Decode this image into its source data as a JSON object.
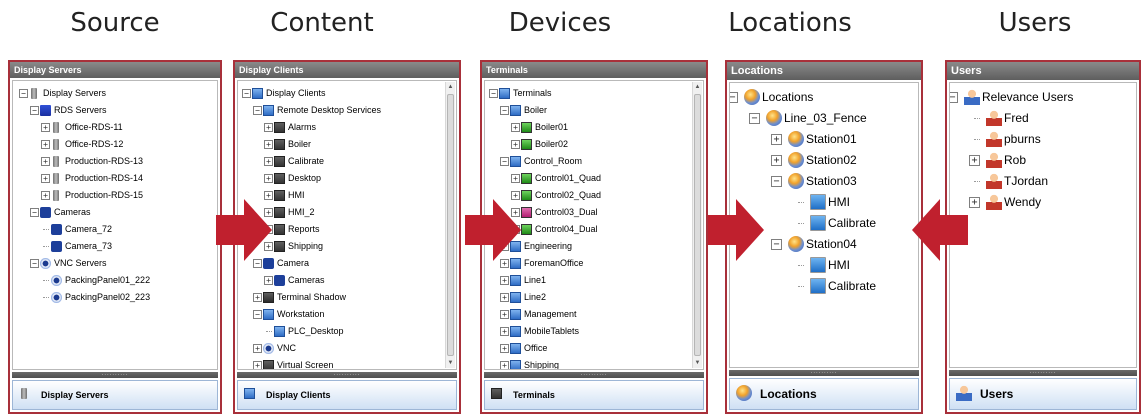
{
  "headings": [
    "Source",
    "Content",
    "Devices",
    "Locations",
    "Users"
  ],
  "colors": {
    "accent_border": "#a8303a",
    "arrow": "#c0202e",
    "footer_bg": "#cfe0f4"
  },
  "panels": {
    "source": {
      "title": "Display Servers",
      "footer": "Display Servers",
      "rows": [
        {
          "label": "Display Servers",
          "icon": "server-icon",
          "exp": "-"
        },
        {
          "label": "RDS Servers",
          "icon": "rds-server-icon",
          "exp": "-"
        },
        {
          "label": "Office-RDS-11",
          "icon": "server-icon",
          "exp": "+"
        },
        {
          "label": "Office-RDS-12",
          "icon": "server-icon",
          "exp": "+"
        },
        {
          "label": "Production-RDS-13",
          "icon": "server-icon",
          "exp": "+"
        },
        {
          "label": "Production-RDS-14",
          "icon": "server-icon",
          "exp": "+"
        },
        {
          "label": "Production-RDS-15",
          "icon": "server-icon",
          "exp": "+"
        },
        {
          "label": "Cameras",
          "icon": "camera-icon",
          "exp": "-"
        },
        {
          "label": "Camera_72",
          "icon": "camera-icon",
          "exp": ""
        },
        {
          "label": "Camera_73",
          "icon": "camera-icon",
          "exp": ""
        },
        {
          "label": "VNC Servers",
          "icon": "eye-icon",
          "exp": "-"
        },
        {
          "label": "PackingPanel01_222",
          "icon": "eye-icon",
          "exp": ""
        },
        {
          "label": "PackingPanel02_223",
          "icon": "eye-icon",
          "exp": ""
        }
      ]
    },
    "content": {
      "title": "Display Clients",
      "footer": "Display Clients",
      "rows": [
        {
          "label": "Display Clients",
          "icon": "client-icon",
          "exp": "-"
        },
        {
          "label": "Remote Desktop Services",
          "icon": "client-icon",
          "exp": "-"
        },
        {
          "label": "Alarms",
          "icon": "monitor-icon",
          "exp": "+"
        },
        {
          "label": "Boiler",
          "icon": "monitor-icon",
          "exp": "+"
        },
        {
          "label": "Calibrate",
          "icon": "monitor-icon",
          "exp": "+"
        },
        {
          "label": "Desktop",
          "icon": "monitor-icon",
          "exp": "+"
        },
        {
          "label": "HMI",
          "icon": "monitor-icon",
          "exp": "+"
        },
        {
          "label": "HMI_2",
          "icon": "monitor-icon",
          "exp": "+"
        },
        {
          "label": "Reports",
          "icon": "monitor-icon",
          "exp": "+"
        },
        {
          "label": "Shipping",
          "icon": "monitor-icon",
          "exp": "+"
        },
        {
          "label": "Camera",
          "icon": "camera-icon",
          "exp": "-"
        },
        {
          "label": "Cameras",
          "icon": "camera-icon",
          "exp": "+"
        },
        {
          "label": "Terminal Shadow",
          "icon": "shadow-icon",
          "exp": "+"
        },
        {
          "label": "Workstation",
          "icon": "workstation-icon",
          "exp": "-"
        },
        {
          "label": "PLC_Desktop",
          "icon": "workstation-icon",
          "exp": ""
        },
        {
          "label": "VNC",
          "icon": "eye-icon",
          "exp": "+"
        },
        {
          "label": "Virtual Screen",
          "icon": "monitor-icon",
          "exp": "+"
        }
      ]
    },
    "devices": {
      "title": "Terminals",
      "footer": "Terminals",
      "rows": [
        {
          "label": "Terminals",
          "icon": "terminal-icon",
          "exp": "-"
        },
        {
          "label": "Boiler",
          "icon": "terminal-group-icon",
          "exp": "-"
        },
        {
          "label": "Boiler01",
          "icon": "green-terminal-icon",
          "exp": "+"
        },
        {
          "label": "Boiler02",
          "icon": "green-terminal-icon",
          "exp": "+"
        },
        {
          "label": "Control_Room",
          "icon": "terminal-group-icon",
          "exp": "-"
        },
        {
          "label": "Control01_Quad",
          "icon": "green-terminal-icon",
          "exp": "+"
        },
        {
          "label": "Control02_Quad",
          "icon": "green-terminal-icon",
          "exp": "+"
        },
        {
          "label": "Control03_Dual",
          "icon": "pink-terminal-icon",
          "exp": "+"
        },
        {
          "label": "Control04_Dual",
          "icon": "green-terminal-icon",
          "exp": "+"
        },
        {
          "label": "Engineering",
          "icon": "terminal-group-icon",
          "exp": "+"
        },
        {
          "label": "ForemanOffice",
          "icon": "terminal-group-icon",
          "exp": "+"
        },
        {
          "label": "Line1",
          "icon": "terminal-group-icon",
          "exp": "+"
        },
        {
          "label": "Line2",
          "icon": "terminal-group-icon",
          "exp": "+"
        },
        {
          "label": "Management",
          "icon": "terminal-group-icon",
          "exp": "+"
        },
        {
          "label": "MobileTablets",
          "icon": "terminal-group-icon",
          "exp": "+"
        },
        {
          "label": "Office",
          "icon": "terminal-group-icon",
          "exp": "+"
        },
        {
          "label": "Shipping",
          "icon": "terminal-group-icon",
          "exp": "+"
        }
      ]
    },
    "locations": {
      "title": "Locations",
      "footer": "Locations",
      "rows": [
        {
          "label": "Locations",
          "icon": "globe-icon",
          "exp": "-"
        },
        {
          "label": "Line_03_Fence",
          "icon": "globe-icon",
          "exp": "-"
        },
        {
          "label": "Station01",
          "icon": "globe-icon",
          "exp": "+"
        },
        {
          "label": "Station02",
          "icon": "globe-icon",
          "exp": "+"
        },
        {
          "label": "Station03",
          "icon": "globe-icon",
          "exp": "-"
        },
        {
          "label": "HMI",
          "icon": "hmi-icon",
          "exp": ""
        },
        {
          "label": "Calibrate",
          "icon": "hmi-icon",
          "exp": ""
        },
        {
          "label": "Station04",
          "icon": "globe-icon",
          "exp": "-"
        },
        {
          "label": "HMI",
          "icon": "hmi-icon",
          "exp": ""
        },
        {
          "label": "Calibrate",
          "icon": "hmi-icon",
          "exp": ""
        }
      ]
    },
    "users": {
      "title": "Users",
      "footer": "Users",
      "rows": [
        {
          "label": "Relevance Users",
          "icon": "user-group-icon",
          "exp": "-"
        },
        {
          "label": "Fred",
          "icon": "user-icon",
          "exp": ""
        },
        {
          "label": "pburns",
          "icon": "user-icon",
          "exp": ""
        },
        {
          "label": "Rob",
          "icon": "user-icon",
          "exp": "+"
        },
        {
          "label": "TJordan",
          "icon": "user-icon",
          "exp": ""
        },
        {
          "label": "Wendy",
          "icon": "user-icon",
          "exp": "+"
        }
      ]
    }
  }
}
